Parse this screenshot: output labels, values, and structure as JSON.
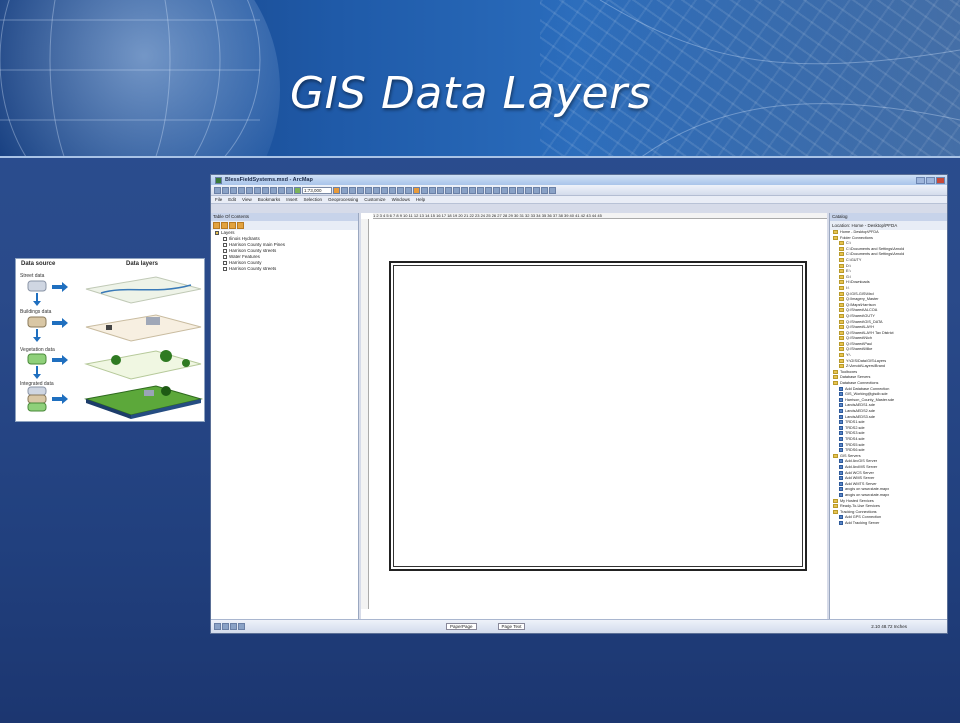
{
  "slide": {
    "title": "GIS Data Layers"
  },
  "figure": {
    "col_source": "Data source",
    "col_layers": "Data layers",
    "rows": [
      "Street data",
      "Buildings data",
      "Vegetation data",
      "Integrated data"
    ]
  },
  "app": {
    "window_title": "BlessFieldSystems.mxd - ArcMap",
    "menu": [
      "File",
      "Edit",
      "View",
      "Bookmarks",
      "Insert",
      "Selection",
      "Geoprocessing",
      "Customize",
      "Windows",
      "Help"
    ],
    "scale_value": "1:73,000",
    "toc": {
      "header": "Table Of Contents",
      "items": [
        "Layers",
        "Ilinois Hydrants",
        "Harrison County main Pines",
        "Harrison County streets",
        "Water Features",
        "Harrison County",
        "Harrison County streets"
      ]
    },
    "catalog": {
      "header": "Catalog",
      "location_label": "Location:",
      "location_value": "Home - Desktop\\PFDA",
      "items": [
        "Home - Desktop\\PFDA",
        "Folder Connections",
        "C:\\",
        "C:\\Documents and Settings\\Arnold",
        "C:\\Documents and Settings\\Arnold",
        "C:\\GUTY",
        "D:\\",
        "E:\\",
        "G:\\",
        "H:\\Downloads",
        "I:\\",
        "Q:\\GIS-GIS\\Mxd",
        "Q:\\Imagery_Master",
        "Q:\\Maps\\Harrison",
        "Q:\\Shared\\ALCOA",
        "Q:\\Shared\\GUTY",
        "Q:\\Shared\\GIS_DATA",
        "Q:\\Shared\\LAYH",
        "Q:\\Shared\\LAYH Tax District",
        "Q:\\Shared\\Nich",
        "Q:\\Shared\\Paul",
        "Q:\\Shared\\Mike",
        "Y:\\",
        "Y:\\GIS\\Data\\GIS\\Layers",
        "Z:\\Arnold\\Layers\\Brand",
        "Toolboxes",
        "Database Servers",
        "Database Connections",
        "Add Database Connection",
        "GIS_Working@gisdb.sde",
        "Harrison_County_Master.sde",
        "LandsAEDS1.sde",
        "LandsAEDS2.sde",
        "LandsAEDS3.sde",
        "TRDS1.sde",
        "TRDS2.sde",
        "TRDS3.sde",
        "TRDS4.sde",
        "TRDS5.sde",
        "TRDS6.sde",
        "GIS Servers",
        "Add ArcGIS Server",
        "Add ArcIMS Server",
        "Add WCS Server",
        "Add WMS Server",
        "Add WMTS Server",
        "arcgis on www.state.mapx",
        "arcgis on www.state.mapx",
        "My Hosted Services",
        "Ready-To-Use Services",
        "Tracking Connections",
        "Add GPS Connection",
        "Add Tracking Server"
      ]
    },
    "bottom_tab": "PaperPage",
    "page_label": "Page Text",
    "coords": "2.10 48.72 Inches",
    "ruler_text": "1 2 3 4 5 6 7 8 9 10 11 12 13 14 15 16 17 18 19 20 21 22 23 24 25 26 27 28 29 30 31 32 33 34 35 36 37 38 39 40 41 42 43 44 45"
  }
}
